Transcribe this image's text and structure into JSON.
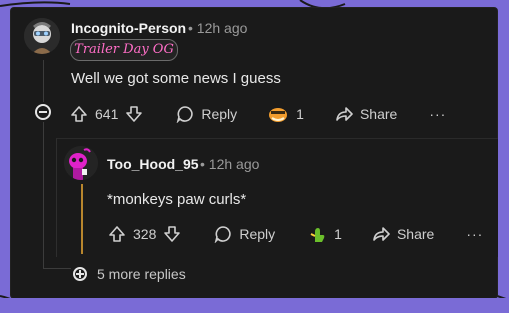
{
  "comment": {
    "author": "Incognito-Person",
    "time": "• 12h ago",
    "flair": "Trailer Day OG",
    "text": "Well we got some news I guess",
    "upvotes": "641",
    "reply_label": "Reply",
    "award_count": "1",
    "share_label": "Share",
    "more_label": "···"
  },
  "reply": {
    "author": "Too_Hood_95",
    "time": "• 12h ago",
    "text": "*monkeys paw curls*",
    "upvotes": "328",
    "reply_label": "Reply",
    "award_count": "1",
    "share_label": "Share",
    "more_label": "···"
  },
  "more_replies": "5 more replies",
  "colors": {
    "background": "#7a6bd6",
    "panel": "#1a1a1a",
    "flair": "#ff6ec7",
    "thread_accent": "#b8862d"
  }
}
